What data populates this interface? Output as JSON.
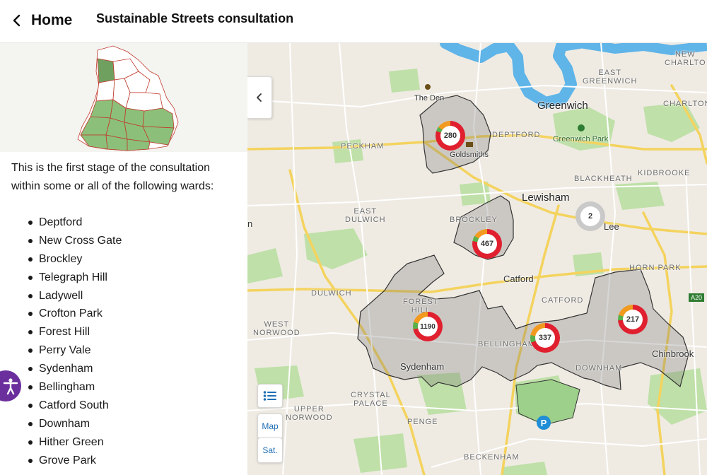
{
  "header": {
    "back_label": "Home",
    "title": "Sustainable Streets consultation"
  },
  "intro_text": "This is the first stage of the consultation within some or all of the following wards:",
  "wards": [
    "Deptford",
    "New Cross Gate",
    "Brockley",
    "Telegraph Hill",
    "Ladywell",
    "Crofton Park",
    "Forest Hill",
    "Perry Vale",
    "Sydenham",
    "Bellingham",
    "Catford South",
    "Downham",
    "Hither Green",
    "Grove Park"
  ],
  "map": {
    "controls": {
      "map_label": "Map",
      "sat_label": "Sat."
    },
    "places": {
      "greenwich": "Greenwich",
      "lewisham": "Lewisham",
      "lee": "Lee",
      "catford": "Catford",
      "sydenham": "Sydenham",
      "chinbrook": "Chinbrook",
      "the_den": "The Den",
      "goldsmiths": "Goldsmiths",
      "greenwich_park": "Greenwich Park",
      "peckham": "PECKHAM",
      "deptford": "DEPTFORD",
      "east_greenwich": "EAST\nGREENWICH",
      "new_charlton": "NEW\nCHARLTO",
      "charlton": "CHARLTON",
      "kidbrooke": "KIDBROOKE",
      "blackheath": "BLACKHEATH",
      "east_dulwich": "EAST\nDULWICH",
      "brockley": "BROCKLEY",
      "dulwich": "DULWICH",
      "forest_hill": "FOREST\nHILL",
      "west_norwood": "WEST\nNORWOOD",
      "bellingham": "BELLINGHAM",
      "catford_caps": "CATFORD",
      "horn_park": "HORN PARK",
      "downham": "DOWNHAM",
      "crystal_palace": "CRYSTAL\nPALACE",
      "upper_norwood": "UPPER\nNORWOOD",
      "penge": "PENGE",
      "beckenham": "BECKENHAM",
      "edge_n": "n",
      "a20": "A20"
    },
    "clusters": [
      {
        "id": "c280",
        "count": "280"
      },
      {
        "id": "c467",
        "count": "467"
      },
      {
        "id": "c1190",
        "count": "1190"
      },
      {
        "id": "c337",
        "count": "337"
      },
      {
        "id": "c217",
        "count": "217"
      },
      {
        "id": "c2",
        "count": "2"
      }
    ],
    "colors": {
      "ring_red": "#e0202f",
      "ring_orange": "#f29a1f",
      "ring_green": "#5ab04a",
      "river": "#5fb4e8",
      "park": "#bfe0a8"
    }
  }
}
